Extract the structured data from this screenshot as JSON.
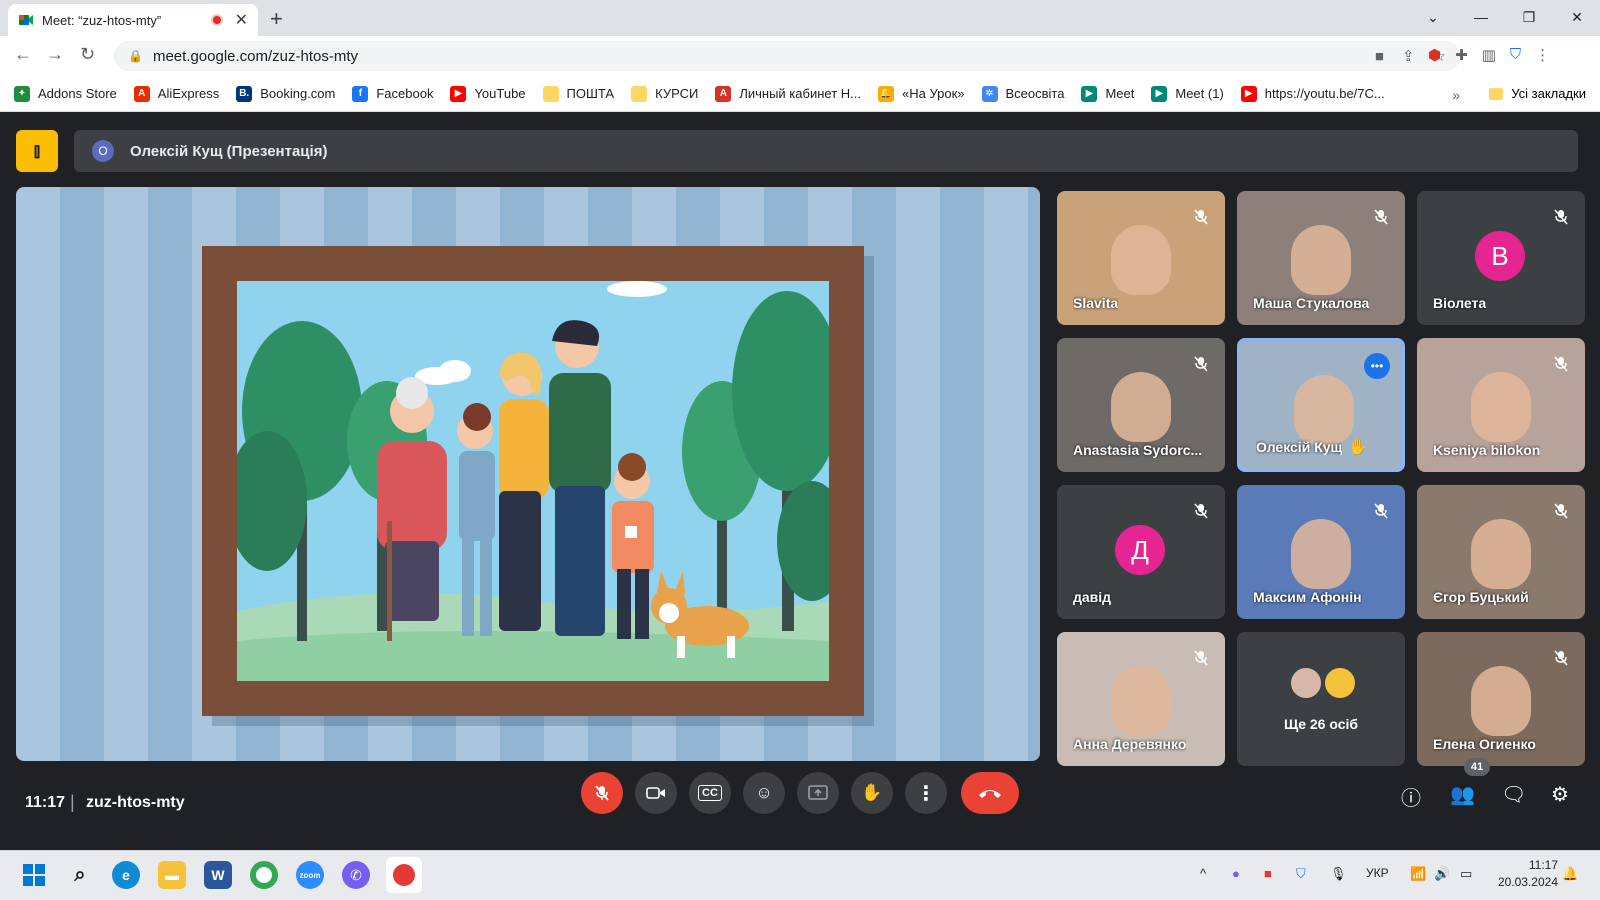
{
  "browser": {
    "tab_title": "Meet: “zuz-htos-mty”",
    "url": "meet.google.com/zuz-htos-mty"
  },
  "bookmarks": [
    {
      "label": "Addons Store",
      "color": "#1e8e3e",
      "glyph": "✦"
    },
    {
      "label": "AliExpress",
      "color": "#e62e04",
      "glyph": "A"
    },
    {
      "label": "Booking.com",
      "color": "#003580",
      "glyph": "B."
    },
    {
      "label": "Facebook",
      "color": "#1877f2",
      "glyph": "f"
    },
    {
      "label": "YouTube",
      "color": "#ff0000",
      "glyph": "▶"
    },
    {
      "label": "ПОШТА",
      "color": "#fdd663",
      "glyph": ""
    },
    {
      "label": "КУРСИ",
      "color": "#fdd663",
      "glyph": ""
    },
    {
      "label": "Личный кабинет Н...",
      "color": "#d93025",
      "glyph": "A"
    },
    {
      "label": "«На Урок»",
      "color": "#f9ab00",
      "glyph": "🔔"
    },
    {
      "label": "Всеосвіта",
      "color": "#4285f4",
      "glyph": "✲"
    },
    {
      "label": "Meet",
      "color": "#00897b",
      "glyph": "▶"
    },
    {
      "label": "Meet (1)",
      "color": "#00897b",
      "glyph": "▶"
    },
    {
      "label": "https://youtu.be/7C...",
      "color": "#ff0000",
      "glyph": "▶"
    }
  ],
  "bookmarks_all": "Усі закладки",
  "meet": {
    "presenter_initial": "О",
    "presenter_label": "Олексій Кущ (Презентація)",
    "time": "11:17",
    "code": "zuz-htos-mty",
    "participants_count": "41"
  },
  "participants": [
    {
      "name": "Slavita",
      "muted": true
    },
    {
      "name": "Маша Стукалова",
      "muted": true
    },
    {
      "name": "Віолета",
      "initial": "В",
      "avatar_color": "#e52592",
      "muted": true
    },
    {
      "name": "Anastasia Sydorc...",
      "muted": true
    },
    {
      "name": "Олексій Кущ",
      "speaking": true,
      "hand_raised": true
    },
    {
      "name": "Kseniya bilokon",
      "muted": true
    },
    {
      "name": "давід",
      "initial": "Д",
      "avatar_color": "#e52592",
      "muted": true
    },
    {
      "name": "Максим Афонін",
      "muted": true
    },
    {
      "name": "Єгор Буцький",
      "muted": true
    },
    {
      "name": "Анна Деревянко",
      "muted": true
    },
    {
      "name": "Ще 26 осіб",
      "more": true
    },
    {
      "name": "Елена Огиенко",
      "muted": true
    }
  ],
  "taskbar": {
    "language": "УКР",
    "time": "11:17",
    "date": "20.03.2024"
  }
}
